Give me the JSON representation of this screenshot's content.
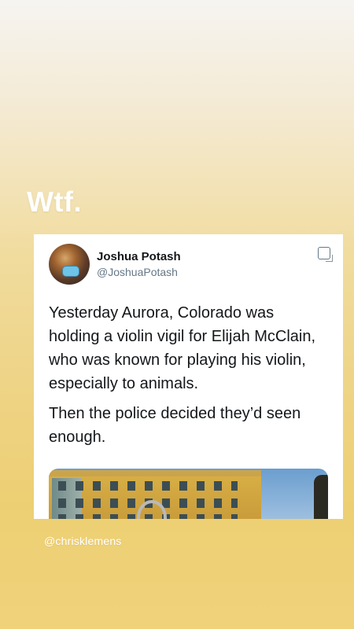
{
  "story": {
    "caption": "Wtf.",
    "credit": "@chrisklemens"
  },
  "tweet": {
    "author_name": "Joshua Potash",
    "author_handle": "@JoshuaPotash",
    "paragraphs": [
      "Yesterday Aurora, Colorado was holding a violin vigil for Elijah McClain, who was known for playing his violin, especially to animals.",
      "Then the police decided they’d seen enough."
    ],
    "icon": "square-icon"
  },
  "colors": {
    "background_top": "#f6f4f1",
    "background_bottom": "#efd27a",
    "card": "#ffffff",
    "text": "#14171a",
    "handle": "#657786"
  }
}
